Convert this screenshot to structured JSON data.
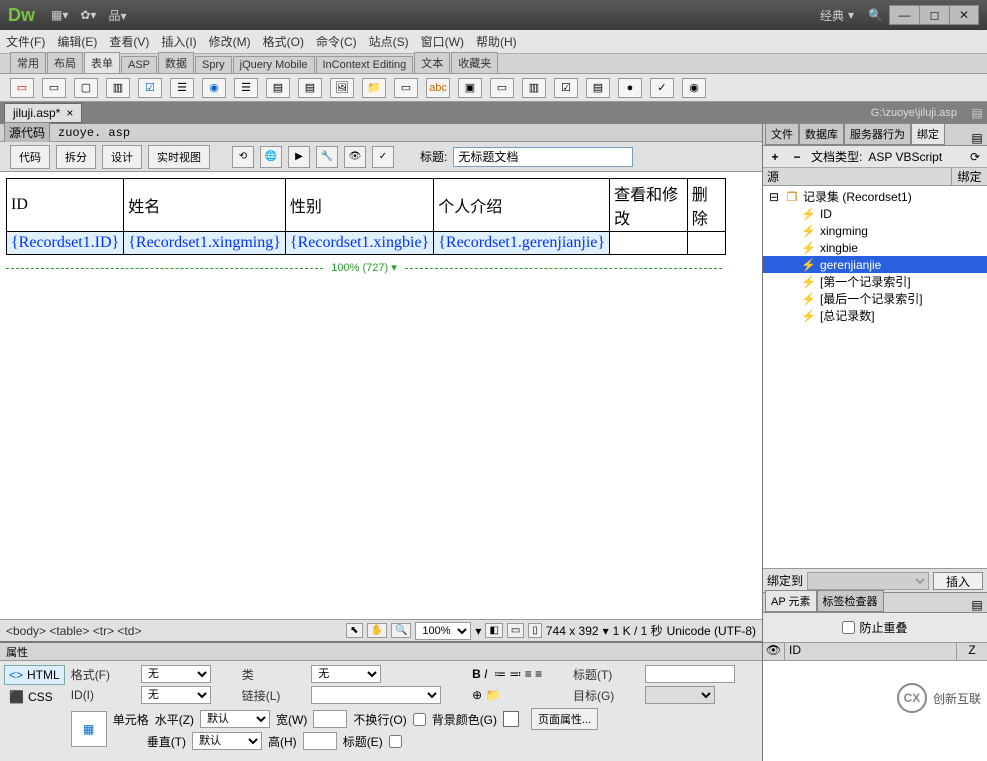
{
  "titlebar": {
    "logo": "Dw",
    "workspace_label": "经典"
  },
  "menu": [
    "文件(F)",
    "编辑(E)",
    "查看(V)",
    "插入(I)",
    "修改(M)",
    "格式(O)",
    "命令(C)",
    "站点(S)",
    "窗口(W)",
    "帮助(H)"
  ],
  "cat_tabs": [
    "常用",
    "布局",
    "表单",
    "ASP",
    "数据",
    "Spry",
    "jQuery Mobile",
    "InContext Editing",
    "文本",
    "收藏夹"
  ],
  "cat_active": 2,
  "doc_tab": {
    "name": "jiluji.asp*",
    "path": "G:\\zuoye\\jiluji.asp"
  },
  "related": {
    "source": "源代码",
    "file": "zuoye. asp"
  },
  "view_btns": [
    "代码",
    "拆分",
    "设计",
    "实时视图"
  ],
  "title_label": "标题:",
  "title_value": "无标题文档",
  "table": {
    "headers": [
      "ID",
      "姓名",
      "性别",
      "个人介绍",
      "查看和修改",
      "删除"
    ],
    "cells": [
      "{Recordset1.ID}",
      "{Recordset1.xingming}",
      "{Recordset1.xingbie}",
      "{Recordset1.gerenjianjie}",
      "",
      ""
    ]
  },
  "ruler": "100% (727) ▾",
  "status": {
    "tags": "<body> <table> <tr> <td>",
    "zoom": "100%",
    "dims": "744 x 392",
    "size": "1 K / 1 秒",
    "encoding": "Unicode (UTF-8)"
  },
  "prop": {
    "panel_title": "属性",
    "mode_html": "HTML",
    "mode_css": "CSS",
    "format_lbl": "格式(F)",
    "format_val": "无",
    "id_lbl": "ID(I)",
    "id_val": "无",
    "class_lbl": "类",
    "class_val": "无",
    "link_lbl": "链接(L)",
    "title_lbl": "标题(T)",
    "target_lbl": "目标(G)",
    "cell_lbl": "单元格",
    "horiz_lbl": "水平(Z)",
    "horiz_val": "默认",
    "vert_lbl": "垂直(T)",
    "vert_val": "默认",
    "width_lbl": "宽(W)",
    "height_lbl": "高(H)",
    "nowrap_lbl": "不换行(O)",
    "header_lbl": "标题(E)",
    "bg_lbl": "背景颜色(G)",
    "page_props": "页面属性..."
  },
  "right": {
    "top_tabs": [
      "文件",
      "数据库",
      "服务器行为",
      "绑定"
    ],
    "top_active": 3,
    "doctype_lbl": "文档类型:",
    "doctype_val": "ASP VBScript",
    "src_hdr": "源",
    "bind_hdr": "绑定",
    "root": "记录集 (Recordset1)",
    "fields": [
      "ID",
      "xingming",
      "xingbie",
      "gerenjianjie",
      "[第一个记录索引]",
      "[最后一个记录索引]",
      "[总记录数]"
    ],
    "selected_idx": 3,
    "bindto_lbl": "绑定到",
    "insert_btn": "插入",
    "ap_tabs": [
      "AP 元素",
      "标签检查器"
    ],
    "ap_active": 0,
    "ap_nooverlap": "防止重叠",
    "ap_cols": [
      "",
      "ID",
      "Z"
    ]
  },
  "brand": "创新互联"
}
